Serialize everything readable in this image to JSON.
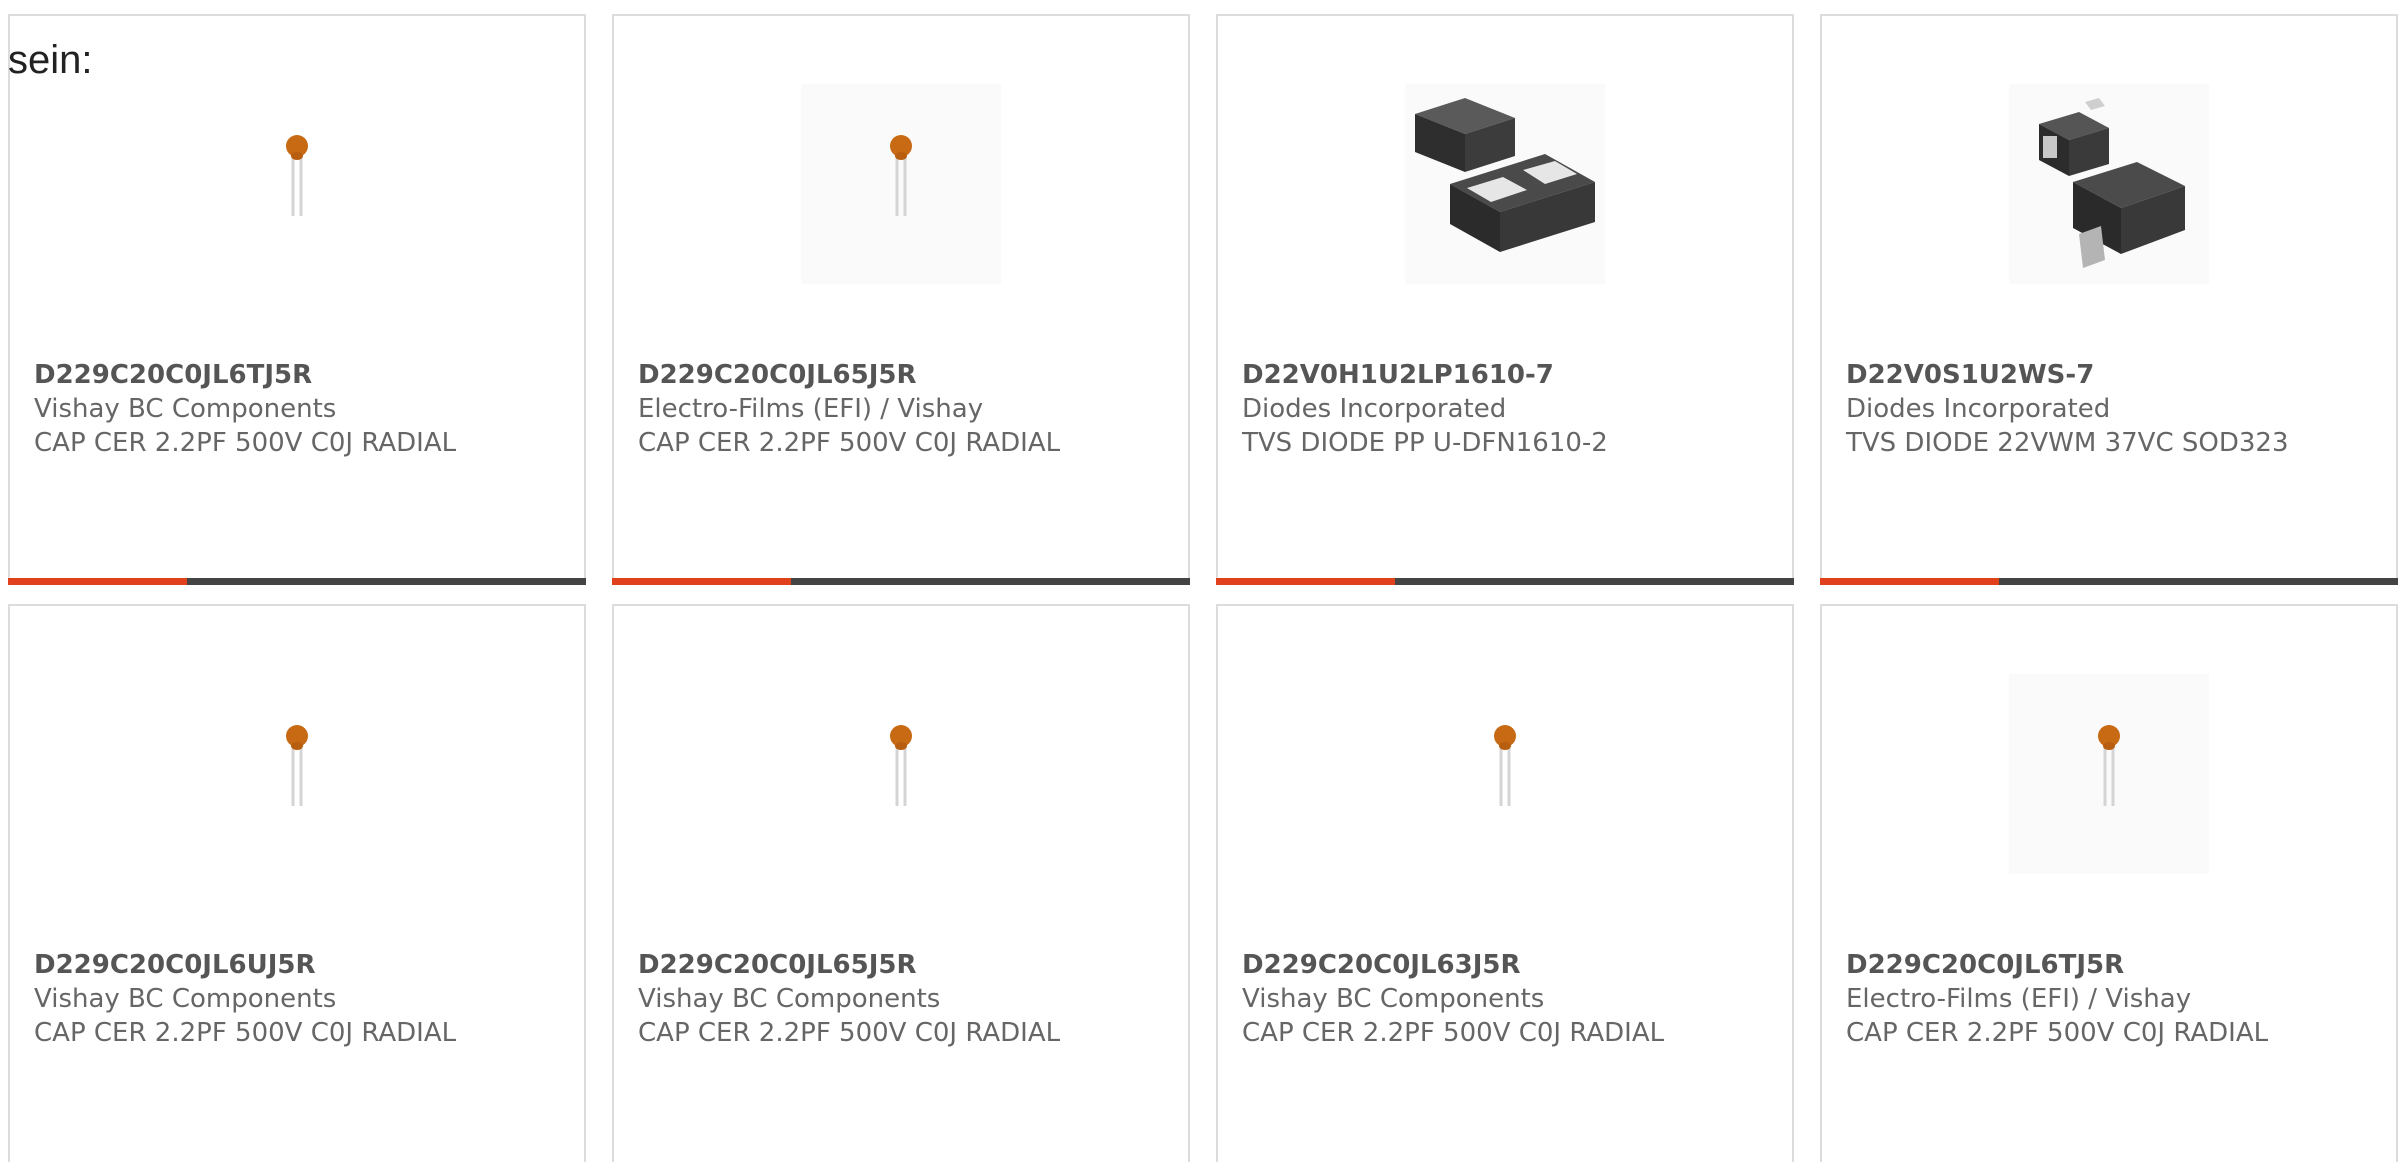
{
  "intro_text": "sein:",
  "accent_color": "#e0401c",
  "bar_color": "#444444",
  "bar_fill_fraction": 0.31,
  "products": [
    {
      "part_number": "D229C20C0JL6TJ5R",
      "manufacturer": "Vishay BC Components",
      "description": "CAP CER 2.2PF 500V C0J RADIAL",
      "image": "radial-capacitor-icon"
    },
    {
      "part_number": "D229C20C0JL65J5R",
      "manufacturer": "Electro-Films (EFI) / Vishay",
      "description": "CAP CER 2.2PF 500V C0J RADIAL",
      "image": "radial-capacitor-icon"
    },
    {
      "part_number": "D22V0H1U2LP1610-7",
      "manufacturer": "Diodes Incorporated",
      "description": "TVS DIODE PP U-DFN1610-2",
      "image": "dfn-diode-icon"
    },
    {
      "part_number": "D22V0S1U2WS-7",
      "manufacturer": "Diodes Incorporated",
      "description": "TVS DIODE 22VWM 37VC SOD323",
      "image": "sod323-diode-icon"
    },
    {
      "part_number": "D229C20C0JL6UJ5R",
      "manufacturer": "Vishay BC Components",
      "description": "CAP CER 2.2PF 500V C0J RADIAL",
      "image": "radial-capacitor-icon"
    },
    {
      "part_number": "D229C20C0JL65J5R",
      "manufacturer": "Vishay BC Components",
      "description": "CAP CER 2.2PF 500V C0J RADIAL",
      "image": "radial-capacitor-icon"
    },
    {
      "part_number": "D229C20C0JL63J5R",
      "manufacturer": "Vishay BC Components",
      "description": "CAP CER 2.2PF 500V C0J RADIAL",
      "image": "radial-capacitor-icon"
    },
    {
      "part_number": "D229C20C0JL6TJ5R",
      "manufacturer": "Electro-Films (EFI) / Vishay",
      "description": "CAP CER 2.2PF 500V C0J RADIAL",
      "image": "radial-capacitor-icon"
    }
  ]
}
